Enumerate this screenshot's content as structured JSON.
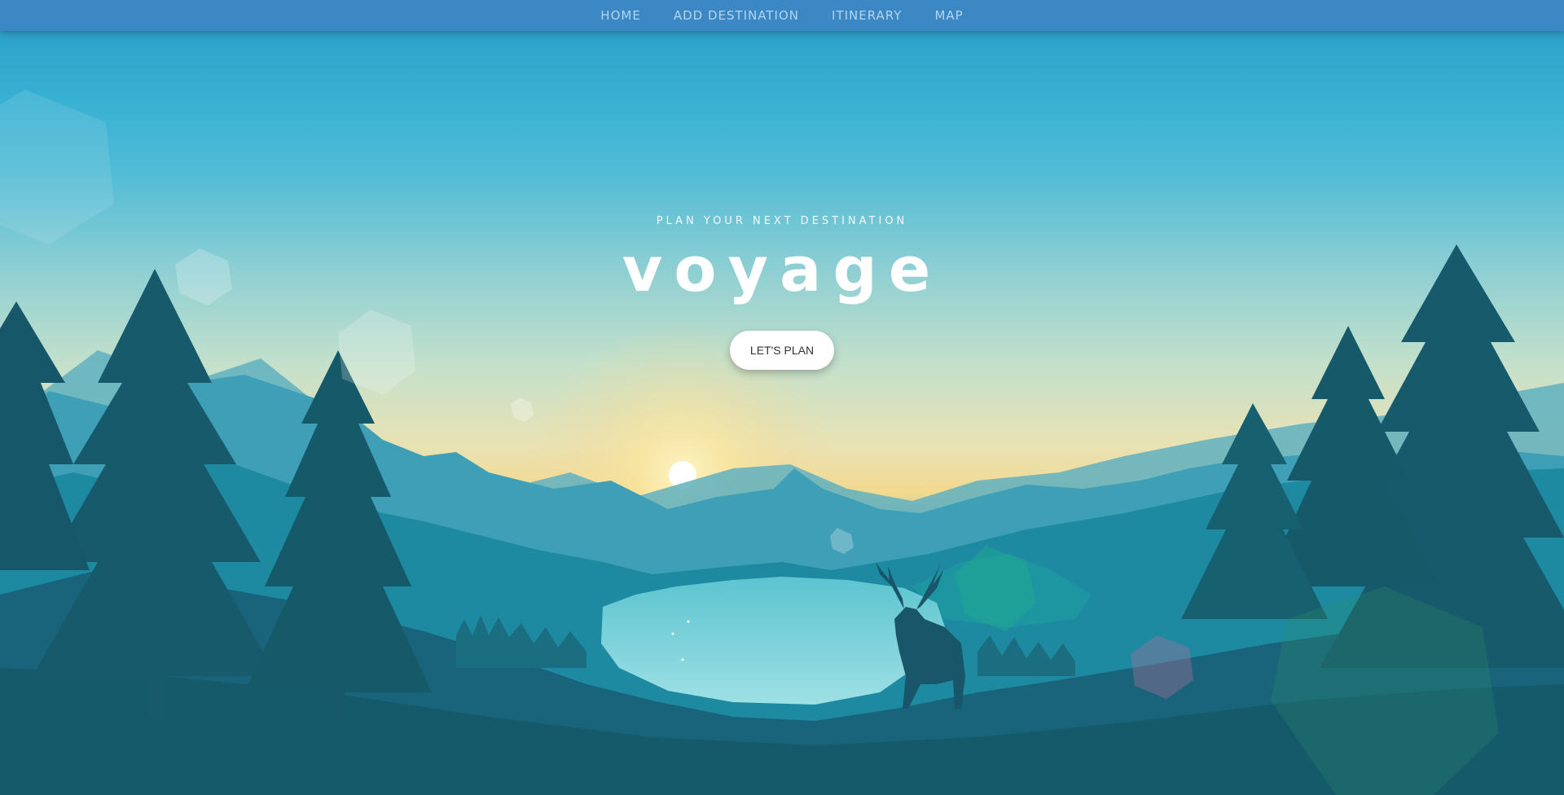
{
  "nav": {
    "items": [
      {
        "label": "HOME"
      },
      {
        "label": "ADD DESTINATION"
      },
      {
        "label": "ITINERARY"
      },
      {
        "label": "MAP"
      }
    ],
    "bg_color": "#3b88c4",
    "text_color": "#b5d4ee"
  },
  "hero": {
    "tagline": "PLAN YOUR NEXT DESTINATION",
    "title": "voyage",
    "cta_label": "LET'S PLAN"
  },
  "background": {
    "icons": [
      "pine-tree-icon",
      "deer-icon",
      "sun-icon",
      "mountain-icon",
      "lake-icon"
    ]
  }
}
